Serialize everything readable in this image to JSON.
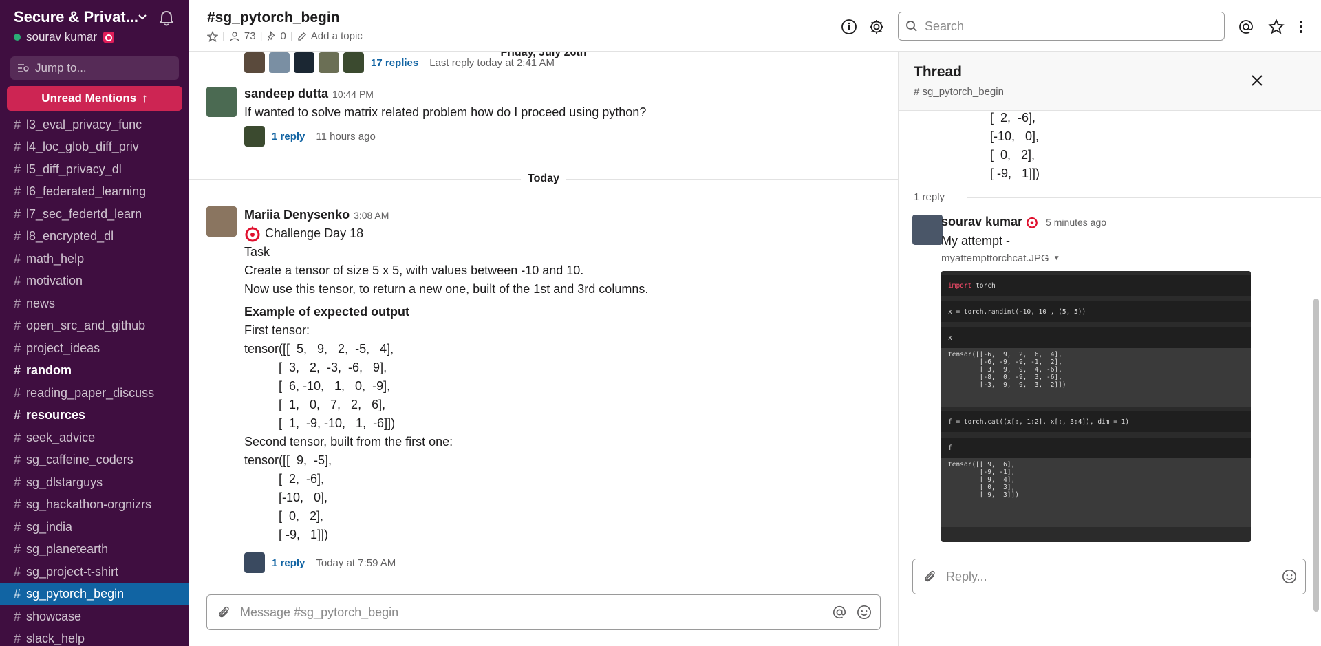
{
  "workspace": {
    "name": "Secure & Privat...",
    "user": "sourav kumar"
  },
  "sidebar": {
    "jump_label": "Jump to...",
    "unread_label": "Unread Mentions",
    "channels": [
      {
        "name": "l3_eval_privacy_func"
      },
      {
        "name": "l4_loc_glob_diff_priv"
      },
      {
        "name": "l5_diff_privacy_dl"
      },
      {
        "name": "l6_federated_learning"
      },
      {
        "name": "l7_sec_federtd_learn"
      },
      {
        "name": "l8_encrypted_dl"
      },
      {
        "name": "math_help"
      },
      {
        "name": "motivation"
      },
      {
        "name": "news"
      },
      {
        "name": "open_src_and_github"
      },
      {
        "name": "project_ideas"
      },
      {
        "name": "random"
      },
      {
        "name": "reading_paper_discuss"
      },
      {
        "name": "resources"
      },
      {
        "name": "seek_advice"
      },
      {
        "name": "sg_caffeine_coders"
      },
      {
        "name": "sg_dlstarguys"
      },
      {
        "name": "sg_hackathon-orgnizrs"
      },
      {
        "name": "sg_india"
      },
      {
        "name": "sg_planetearth"
      },
      {
        "name": "sg_project-t-shirt"
      },
      {
        "name": "sg_pytorch_begin"
      },
      {
        "name": "showcase"
      },
      {
        "name": "slack_help"
      }
    ]
  },
  "header": {
    "channel": "#sg_pytorch_begin",
    "members": "73",
    "pins": "0",
    "add_topic": "Add a topic",
    "search_placeholder": "Search"
  },
  "messages": {
    "top_thread": {
      "replies": "17 replies",
      "last_reply": "Last reply today at 2:41 AM"
    },
    "date1": "Friday, July 26th",
    "date2": "Today",
    "msg1": {
      "author": "sandeep dutta",
      "time": "10:44 PM",
      "text": "If wanted to solve matrix related problem how do I proceed using python?",
      "reply": "1 reply",
      "reply_time": "11 hours ago"
    },
    "msg2": {
      "author": "Mariia Denysenko",
      "time": "3:08 AM",
      "challenge": "Challenge Day 18",
      "task": "Task",
      "line1": "Create a tensor of size 5 x 5, with values between -10 and 10.",
      "line2": "Now use this tensor, to return a new one, built of the 1st and 3rd columns.",
      "example_header": "Example of expected output",
      "first_label": "First tensor:",
      "first_tensor": "tensor([[  5,   9,   2,  -5,   4],\n          [  3,   2,  -3,  -6,   9],\n          [  6, -10,   1,   0,  -9],\n          [  1,   0,   7,   2,   6],\n          [  1,  -9, -10,   1,  -6]])",
      "second_label": "Second tensor, built from the first one:",
      "second_tensor": "tensor([[  9,  -5],\n          [  2,  -6],\n          [-10,   0],\n          [  0,   2],\n          [ -9,   1]])",
      "reply": "1 reply",
      "reply_time": "Today at 7:59 AM"
    },
    "composer_placeholder": "Message #sg_pytorch_begin"
  },
  "thread": {
    "title": "Thread",
    "channel": "# sg_pytorch_begin",
    "top_code": "[  2,  -6],\n[-10,   0],\n[  0,   2],\n[ -9,   1]])",
    "reply_count": "1 reply",
    "reply": {
      "author": "sourav kumar",
      "time": "5 minutes ago",
      "text": "My attempt -",
      "file": "myattempttorchcat.JPG"
    },
    "code": {
      "cell1": "torch",
      "cell1_kw": "import",
      "cell2": "x = torch.randint(-10, 10 , (5, 5))",
      "cell3": "x",
      "out3": "tensor([[-6,  9,  2,  6,  4],\n        [-6, -9, -9, -1,  2],\n        [ 3,  9,  9,  4, -6],\n        [-8,  0, -9,  3, -6],\n        [-3,  9,  9,  3,  2]])",
      "cell4": "f = torch.cat((x[:, 1:2], x[:, 3:4]), dim = 1)",
      "cell5": "f",
      "out5": "tensor([[ 9,  6],\n        [-9, -1],\n        [ 9,  4],\n        [ 0,  3],\n        [ 9,  3]])"
    },
    "composer_placeholder": "Reply..."
  }
}
